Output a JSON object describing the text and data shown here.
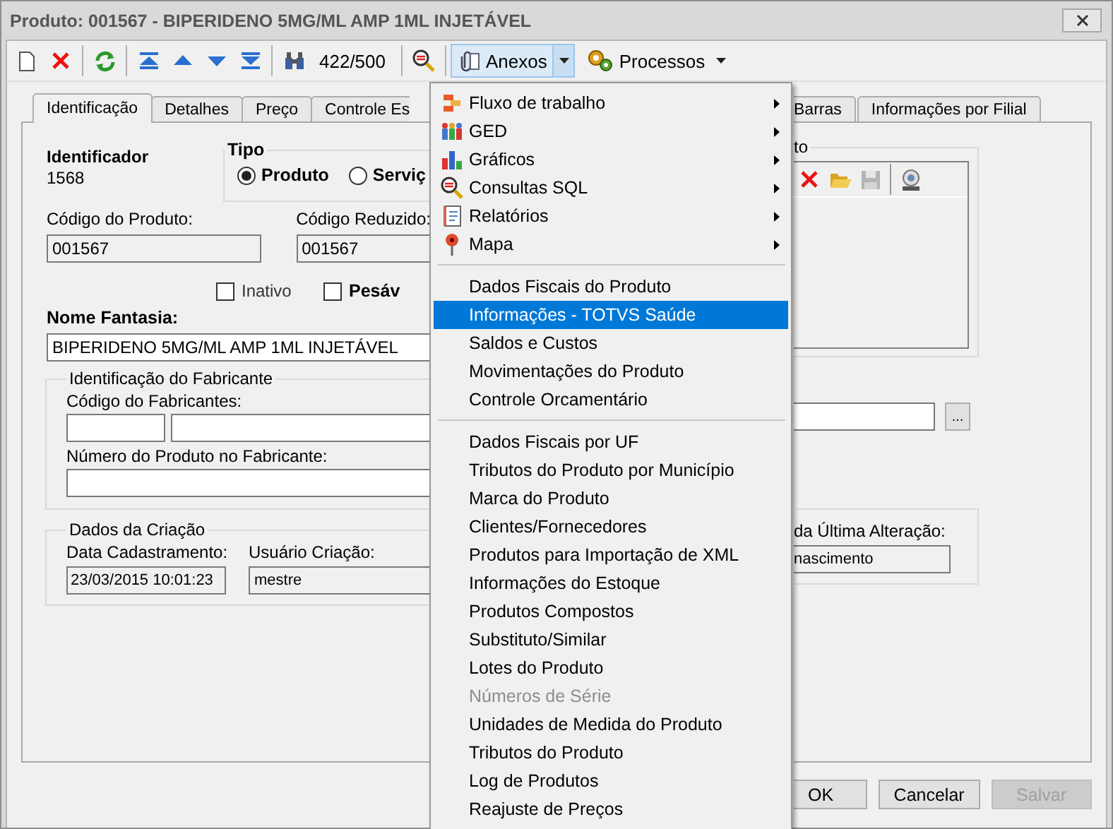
{
  "window": {
    "title": "Produto: 001567 - BIPERIDENO 5MG/ML AMP 1ML INJETÁVEL"
  },
  "toolbar": {
    "record_counter": "422/500",
    "buttons": [
      {
        "label": "Anexos",
        "expanded": true
      },
      {
        "label": "Processos",
        "expanded": false
      }
    ]
  },
  "tabs": {
    "before_menu": [
      {
        "label": "Identificação",
        "selected": true
      },
      {
        "label": "Detalhes",
        "selected": false
      },
      {
        "label": "Preço",
        "selected": false
      },
      {
        "label": "Controle Es",
        "selected": false
      }
    ],
    "after_menu": [
      {
        "label": "Barras",
        "selected": false
      },
      {
        "label": "Informações por Filial",
        "selected": false
      }
    ]
  },
  "form": {
    "identifier": {
      "label": "Identificador",
      "value": "1568"
    },
    "type_group": {
      "title": "Tipo",
      "options": [
        {
          "label": "Produto",
          "selected": true
        },
        {
          "label": "Serviç",
          "selected": false
        }
      ]
    },
    "product_code": {
      "label": "Código do Produto:",
      "value": "001567",
      "read_only": true
    },
    "short_code": {
      "label": "Código Reduzido:",
      "value": "001567",
      "read_only": true
    },
    "checkboxes": [
      {
        "label": "Inativo",
        "checked": false,
        "emphasized": false
      },
      {
        "label": "Pesáv",
        "checked": false,
        "emphasized": true
      }
    ],
    "trade_name": {
      "label": "Nome Fantasia:",
      "value": "BIPERIDENO 5MG/ML AMP 1ML INJETÁVEL",
      "read_only": false
    },
    "manufacturer_group": {
      "title": "Identificação do Fabricante",
      "code_label": "Código do Fabricantes:",
      "number_label": "Número do Produto no Fabricante:"
    },
    "creation_group": {
      "title": "Dados da Criação",
      "date": {
        "label": "Data Cadastramento:",
        "value": "23/03/2015 10:01:23"
      },
      "user": {
        "label": "Usuário Criação:",
        "value": "mestre"
      }
    },
    "attachment_group": {
      "title": "to"
    },
    "lookup_button": "...",
    "last_change": {
      "label": "da Última Alteração:",
      "value": "nascimento"
    }
  },
  "dialog_buttons": [
    {
      "label": "OK",
      "disabled": false
    },
    {
      "label": "Cancelar",
      "disabled": false
    },
    {
      "label": "Salvar",
      "disabled": true
    }
  ],
  "menu": {
    "items": [
      {
        "kind": "submenu",
        "label": "Fluxo de trabalho",
        "selected": false,
        "disabled": false
      },
      {
        "kind": "submenu",
        "label": "GED",
        "selected": false,
        "disabled": false
      },
      {
        "kind": "submenu",
        "label": "Gráficos",
        "selected": false,
        "disabled": false
      },
      {
        "kind": "submenu",
        "label": "Consultas SQL",
        "selected": false,
        "disabled": false
      },
      {
        "kind": "submenu",
        "label": "Relatórios",
        "selected": false,
        "disabled": false
      },
      {
        "kind": "submenu",
        "label": "Mapa",
        "selected": false,
        "disabled": false
      },
      {
        "kind": "separator"
      },
      {
        "kind": "item",
        "label": "Dados Fiscais do Produto",
        "selected": false,
        "disabled": false
      },
      {
        "kind": "item",
        "label": "Informações - TOTVS Saúde",
        "selected": true,
        "disabled": false
      },
      {
        "kind": "item",
        "label": "Saldos e Custos",
        "selected": false,
        "disabled": false
      },
      {
        "kind": "item",
        "label": "Movimentações do Produto",
        "selected": false,
        "disabled": false
      },
      {
        "kind": "item",
        "label": "Controle Orcamentário",
        "selected": false,
        "disabled": false
      },
      {
        "kind": "separator"
      },
      {
        "kind": "item",
        "label": "Dados Fiscais por UF",
        "selected": false,
        "disabled": false
      },
      {
        "kind": "item",
        "label": "Tributos do Produto por Município",
        "selected": false,
        "disabled": false
      },
      {
        "kind": "item",
        "label": "Marca do Produto",
        "selected": false,
        "disabled": false
      },
      {
        "kind": "item",
        "label": "Clientes/Fornecedores",
        "selected": false,
        "disabled": false
      },
      {
        "kind": "item",
        "label": "Produtos para Importação de XML",
        "selected": false,
        "disabled": false
      },
      {
        "kind": "item",
        "label": "Informações do Estoque",
        "selected": false,
        "disabled": false
      },
      {
        "kind": "item",
        "label": "Produtos Compostos",
        "selected": false,
        "disabled": false
      },
      {
        "kind": "item",
        "label": "Substituto/Similar",
        "selected": false,
        "disabled": false
      },
      {
        "kind": "item",
        "label": "Lotes do Produto",
        "selected": false,
        "disabled": false
      },
      {
        "kind": "item",
        "label": "Números de Série",
        "selected": false,
        "disabled": true
      },
      {
        "kind": "item",
        "label": "Unidades de Medida do Produto",
        "selected": false,
        "disabled": false
      },
      {
        "kind": "item",
        "label": "Tributos do Produto",
        "selected": false,
        "disabled": false
      },
      {
        "kind": "item",
        "label": "Log de Produtos",
        "selected": false,
        "disabled": false
      },
      {
        "kind": "item",
        "label": "Reajuste de Preços",
        "selected": false,
        "disabled": false
      }
    ]
  }
}
